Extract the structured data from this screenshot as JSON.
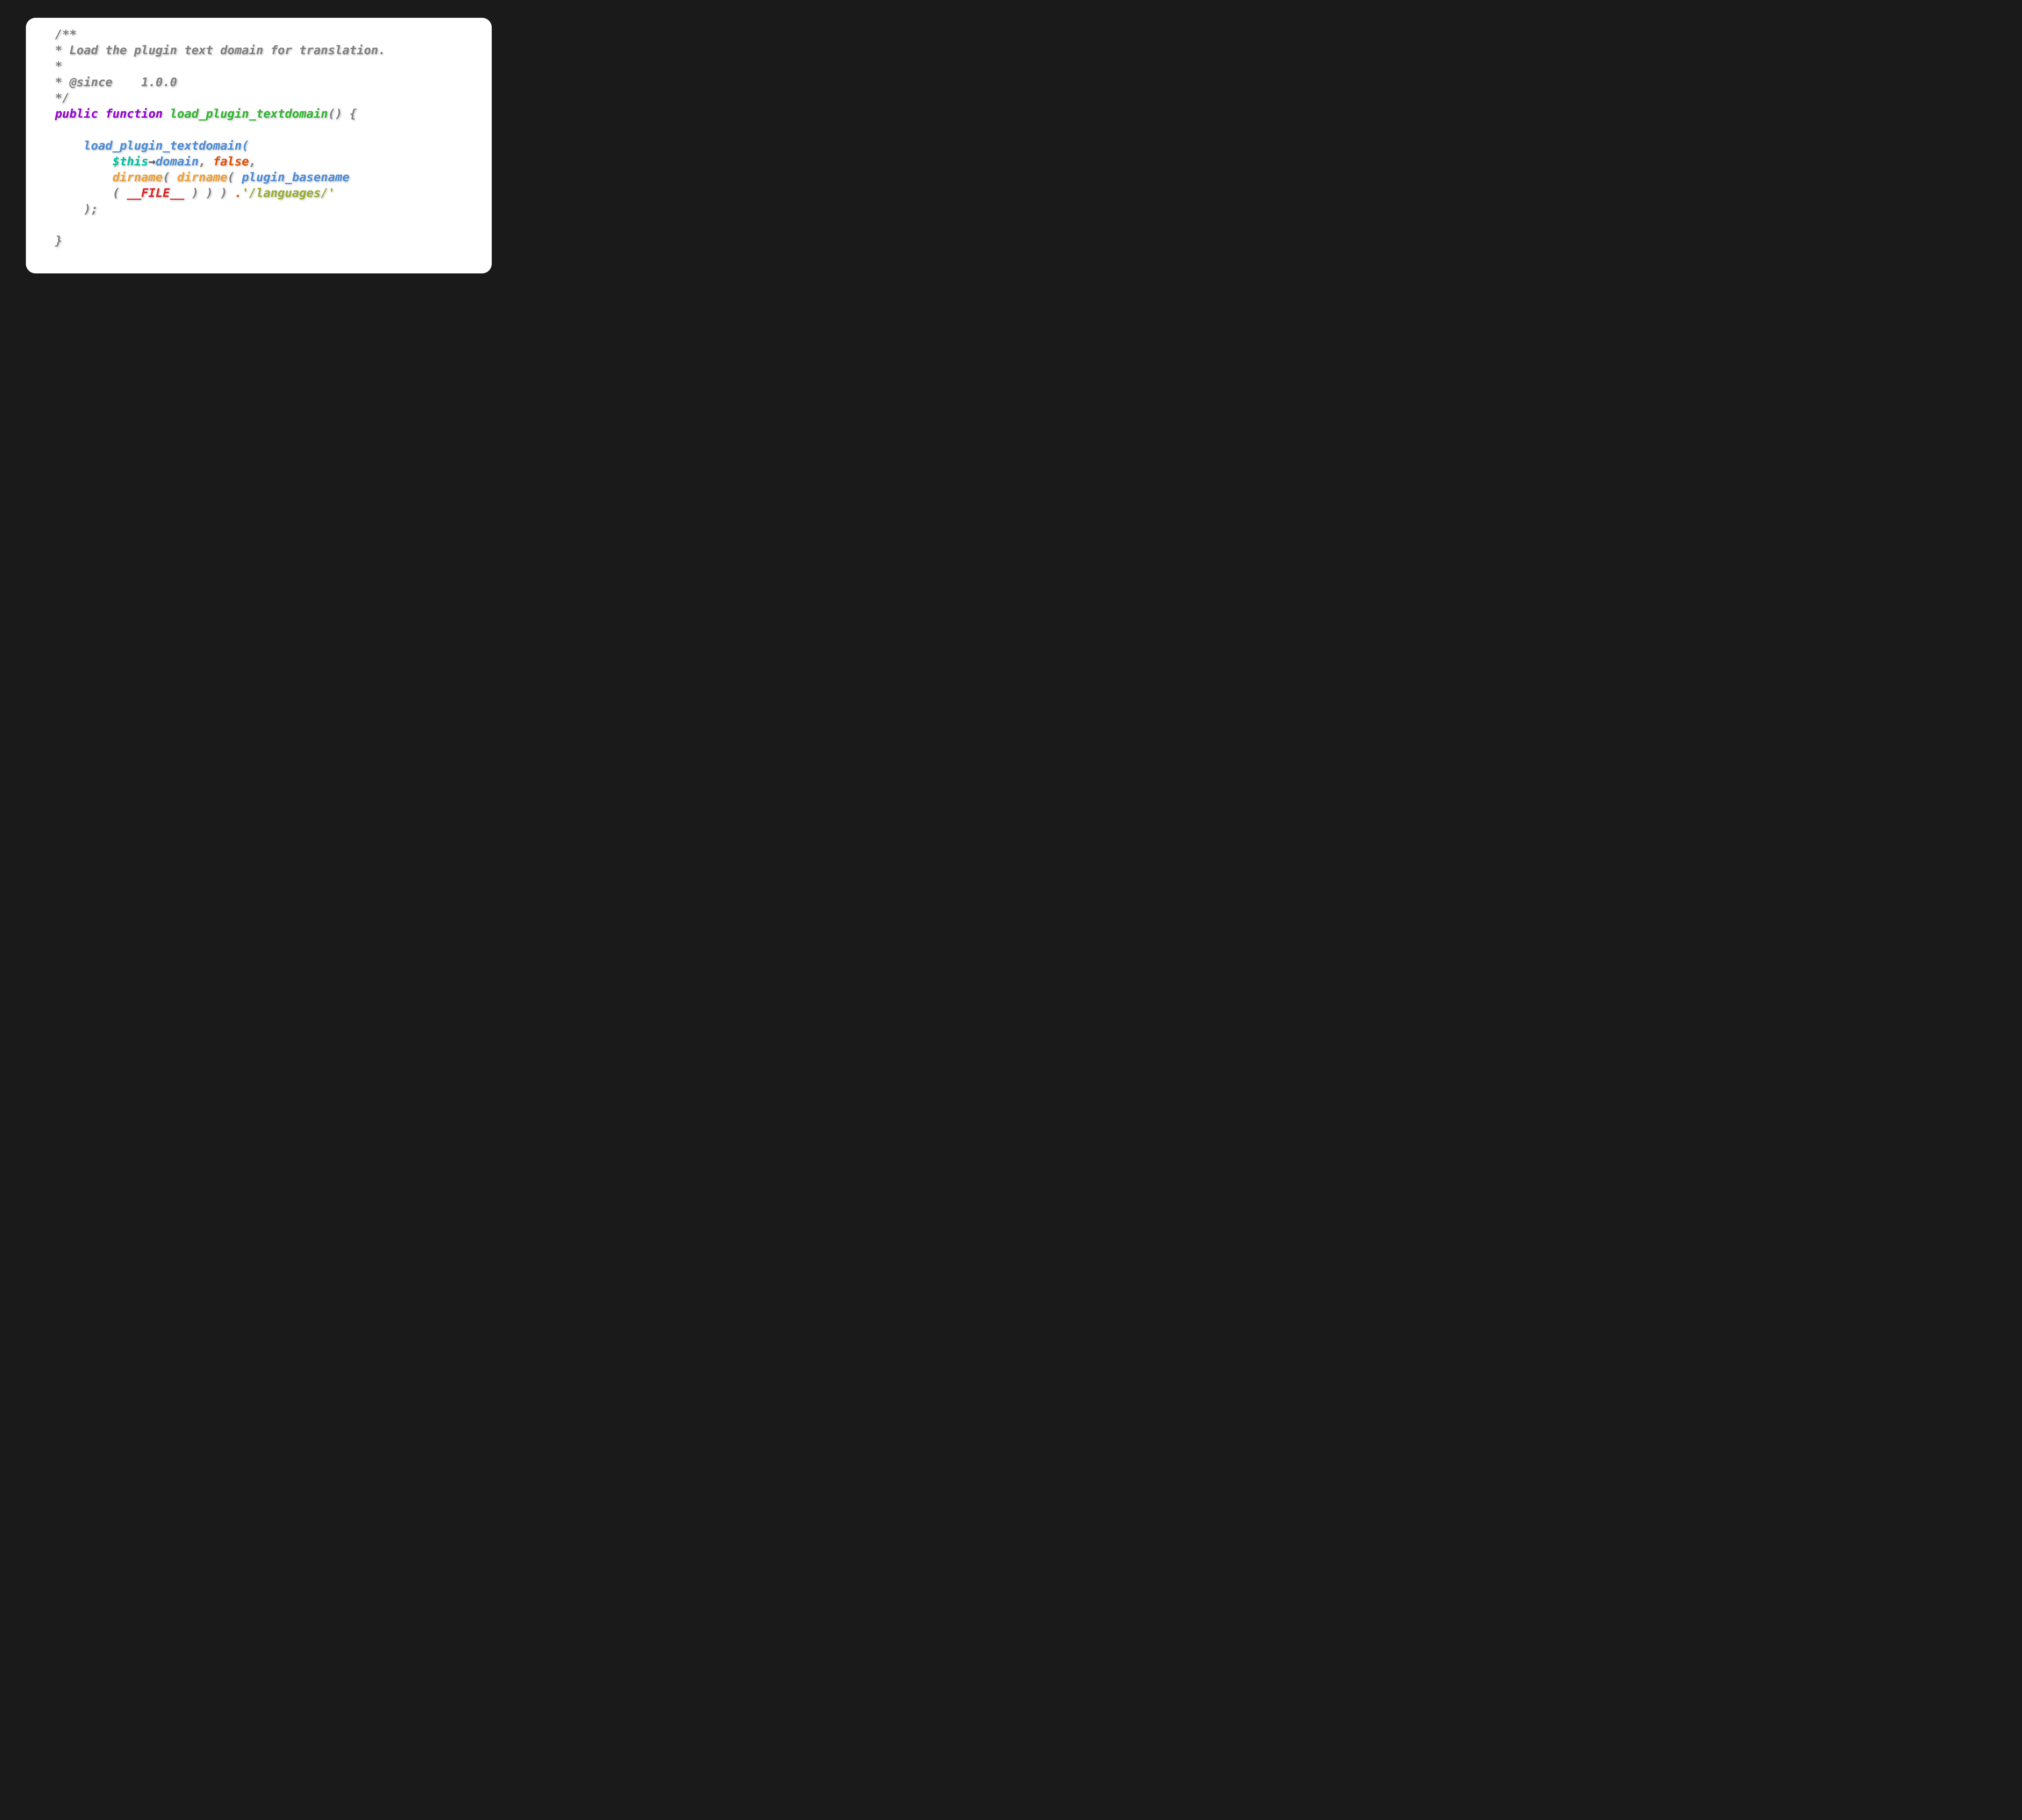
{
  "code": {
    "comment_open": "/**",
    "comment_line1": "* Load the plugin text domain for translation.",
    "comment_line2": "*",
    "comment_line3_prefix": "* @since    ",
    "comment_version": "1.0.0",
    "comment_close": "*/",
    "kw_public": "public",
    "kw_function": "function",
    "fn_name": "load_plugin_textdomain",
    "open_paren_close_brace": "()",
    "open_brace": " {",
    "call_fn": "load_plugin_textdomain",
    "call_open": "(",
    "var_this": "$this",
    "arrow": "→",
    "prop_domain": "domain",
    "comma1": ",",
    "lit_false": "false",
    "comma2": ",",
    "dirname1": "dirname",
    "paren1_open": "(",
    "dirname2": "dirname",
    "paren2_open": "(",
    "plugin_basename": "plugin_basename",
    "paren3_open": "(",
    "magic_file": "__FILE__",
    "paren_close_3": " ) ) )",
    "concat_dot": " .",
    "string_lang": "'/languages/'",
    "call_close": ");",
    "close_brace": "}"
  }
}
